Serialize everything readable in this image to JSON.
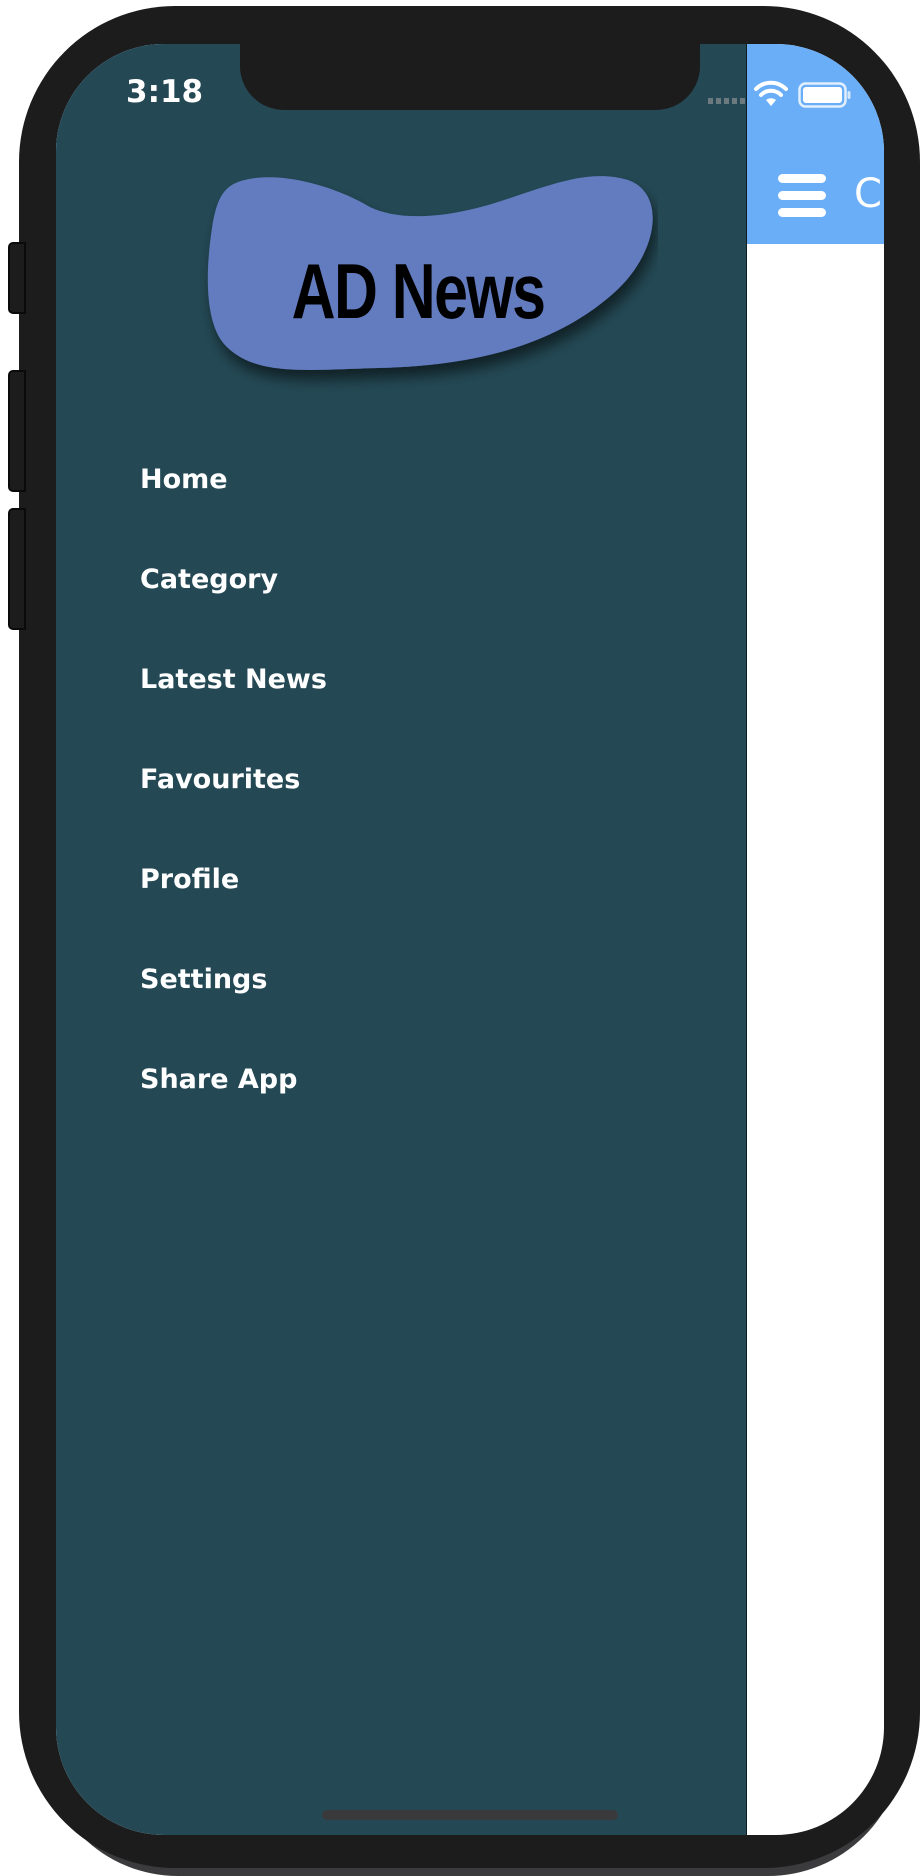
{
  "status_bar": {
    "time": "3:18",
    "icons": [
      "cellular-dots-icon",
      "wifi-icon",
      "battery-icon"
    ]
  },
  "drawer": {
    "logo_text": "AD News",
    "items": [
      {
        "label": "Home"
      },
      {
        "label": "Category"
      },
      {
        "label": "Latest News"
      },
      {
        "label": "Favourites"
      },
      {
        "label": "Profile"
      },
      {
        "label": "Settings"
      },
      {
        "label": "Share App"
      }
    ]
  },
  "main": {
    "header_title_fragment": "C",
    "menu_icon": "hamburger-menu-icon"
  },
  "colors": {
    "drawer_bg": "#244955",
    "header_bg": "#6aaef8",
    "logo_blob": "#647cc0",
    "text": "#ffffff"
  }
}
